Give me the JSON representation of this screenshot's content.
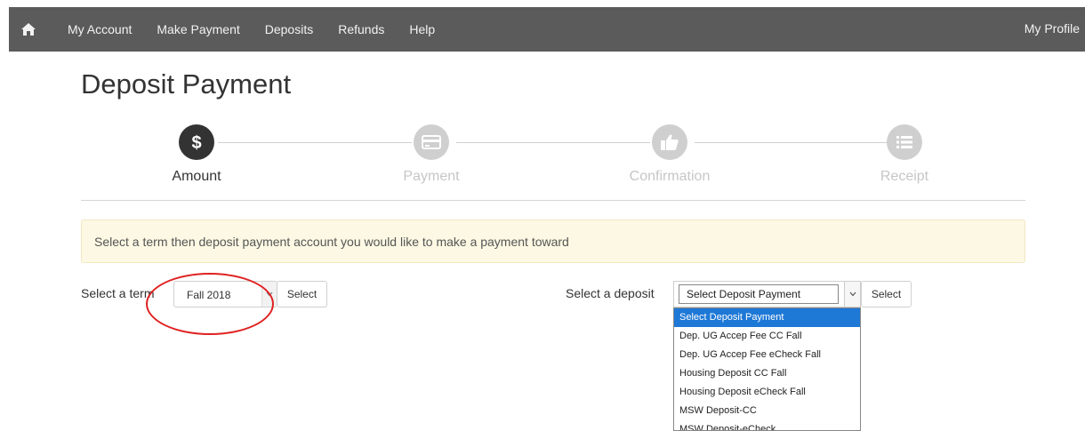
{
  "nav": {
    "items": [
      {
        "label": "My Account"
      },
      {
        "label": "Make Payment"
      },
      {
        "label": "Deposits"
      },
      {
        "label": "Refunds"
      },
      {
        "label": "Help"
      }
    ],
    "profile": "My Profile",
    "home_icon": "home-icon"
  },
  "page": {
    "title": "Deposit Payment"
  },
  "wizard": {
    "steps": [
      {
        "label": "Amount",
        "icon": "dollar-icon",
        "active": true
      },
      {
        "label": "Payment",
        "icon": "credit-card-icon",
        "active": false
      },
      {
        "label": "Confirmation",
        "icon": "thumbs-up-icon",
        "active": false
      },
      {
        "label": "Receipt",
        "icon": "list-icon",
        "active": false
      }
    ]
  },
  "alert": {
    "text": "Select a term then deposit payment account you would like to make a payment toward"
  },
  "term": {
    "label": "Select a term",
    "value": "Fall 2018",
    "button": "Select"
  },
  "deposit": {
    "label": "Select a deposit",
    "value": "Select Deposit Payment",
    "button": "Select",
    "options": [
      "Select Deposit Payment",
      "Dep. UG Accep Fee CC Fall",
      "Dep. UG Accep Fee eCheck Fall",
      "Housing Deposit CC Fall",
      "Housing Deposit eCheck Fall",
      "MSW Deposit-CC",
      "MSW Deposit-eCheck"
    ],
    "highlighted_option": "Select Deposit Payment"
  },
  "colors": {
    "nav_bg": "#5b5b5b",
    "alert_bg": "#fcf8e3",
    "dropdown_highlight": "#1e78d6",
    "annotation": "#e02020",
    "step_active": "#333333",
    "step_inactive": "#cfcfcf"
  }
}
